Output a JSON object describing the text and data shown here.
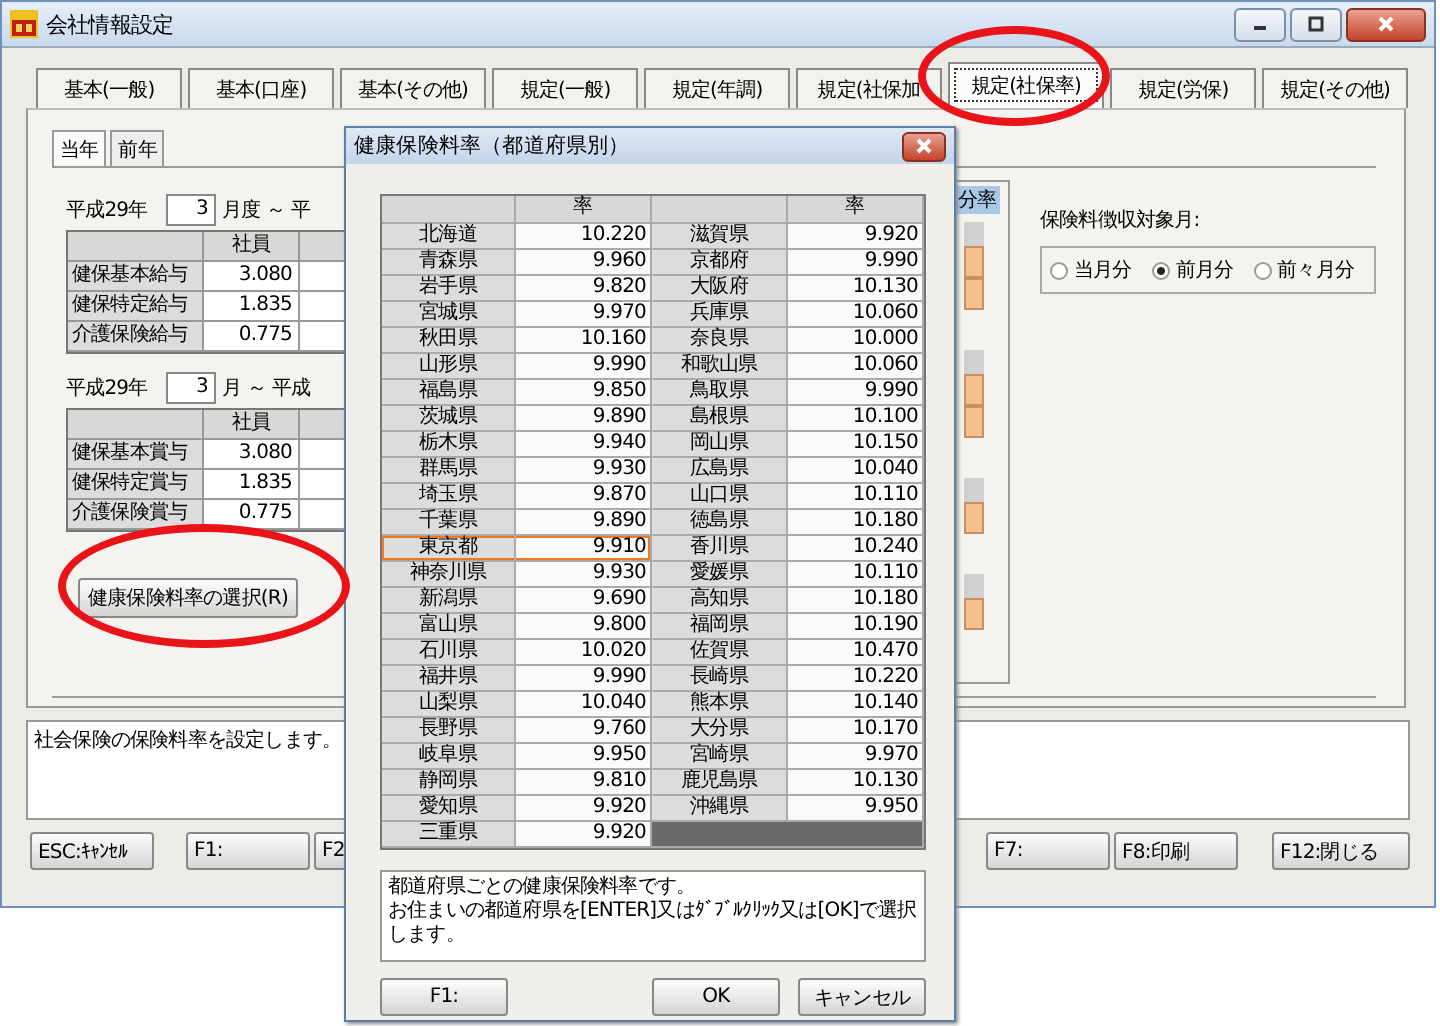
{
  "window": {
    "title": "会社情報設定",
    "tabs": [
      {
        "label": "基本(一般)",
        "selected": false
      },
      {
        "label": "基本(口座)",
        "selected": false
      },
      {
        "label": "基本(その他)",
        "selected": false
      },
      {
        "label": "規定(一般)",
        "selected": false
      },
      {
        "label": "規定(年調)",
        "selected": false
      },
      {
        "label": "規定(社保加",
        "selected": false
      },
      {
        "label": "規定(社保率)",
        "selected": true
      },
      {
        "label": "規定(労保)",
        "selected": false
      },
      {
        "label": "規定(その他)",
        "selected": false
      }
    ],
    "sub_tabs": [
      {
        "label": "当年",
        "selected": true
      },
      {
        "label": "前年",
        "selected": false
      }
    ],
    "periods": [
      {
        "era": "平成29年",
        "month": "3",
        "suffix": "月度 ～ 平",
        "column": "社員",
        "rows": [
          {
            "label": "健保基本給与",
            "value": "3.080"
          },
          {
            "label": "健保特定給与",
            "value": "1.835"
          },
          {
            "label": "介護保険給与",
            "value": "0.775"
          }
        ]
      },
      {
        "era": "平成29年",
        "month": "3",
        "suffix": "月 ～ 平成",
        "column": "社員",
        "rows": [
          {
            "label": "健保基本賞与",
            "value": "3.080"
          },
          {
            "label": "健保特定賞与",
            "value": "1.835"
          },
          {
            "label": "介護保険賞与",
            "value": "0.775"
          }
        ]
      }
    ],
    "rate_button": "健康保険料率の選択(R)",
    "partial_header": "分率",
    "collection_month": {
      "label": "保険料徴収対象月:",
      "options": [
        {
          "label": "当月分",
          "selected": false
        },
        {
          "label": "前月分",
          "selected": true
        },
        {
          "label": "前々月分",
          "selected": false
        }
      ]
    },
    "description": "社会保険の保険料率を設定します。",
    "function_keys": {
      "left": [
        "ESC:ｷｬﾝｾﾙ",
        "F1:",
        "F2"
      ],
      "right": [
        "F7:",
        "F8:印刷",
        "F12:閉じる"
      ]
    }
  },
  "dialog": {
    "title": "健康保険料率（都道府県別）",
    "columns": [
      "率",
      "率"
    ],
    "rows": [
      {
        "left": {
          "name": "北海道",
          "rate": "10.220",
          "selected": false
        },
        "right": {
          "name": "滋賀県",
          "rate": "9.920",
          "selected": false
        }
      },
      {
        "left": {
          "name": "青森県",
          "rate": "9.960",
          "selected": false
        },
        "right": {
          "name": "京都府",
          "rate": "9.990",
          "selected": false
        }
      },
      {
        "left": {
          "name": "岩手県",
          "rate": "9.820",
          "selected": false
        },
        "right": {
          "name": "大阪府",
          "rate": "10.130",
          "selected": false
        }
      },
      {
        "left": {
          "name": "宮城県",
          "rate": "9.970",
          "selected": false
        },
        "right": {
          "name": "兵庫県",
          "rate": "10.060",
          "selected": false
        }
      },
      {
        "left": {
          "name": "秋田県",
          "rate": "10.160",
          "selected": false
        },
        "right": {
          "name": "奈良県",
          "rate": "10.000",
          "selected": false
        }
      },
      {
        "left": {
          "name": "山形県",
          "rate": "9.990",
          "selected": false
        },
        "right": {
          "name": "和歌山県",
          "rate": "10.060",
          "selected": false
        }
      },
      {
        "left": {
          "name": "福島県",
          "rate": "9.850",
          "selected": false
        },
        "right": {
          "name": "鳥取県",
          "rate": "9.990",
          "selected": false
        }
      },
      {
        "left": {
          "name": "茨城県",
          "rate": "9.890",
          "selected": false
        },
        "right": {
          "name": "島根県",
          "rate": "10.100",
          "selected": false
        }
      },
      {
        "left": {
          "name": "栃木県",
          "rate": "9.940",
          "selected": false
        },
        "right": {
          "name": "岡山県",
          "rate": "10.150",
          "selected": false
        }
      },
      {
        "left": {
          "name": "群馬県",
          "rate": "9.930",
          "selected": false
        },
        "right": {
          "name": "広島県",
          "rate": "10.040",
          "selected": false
        }
      },
      {
        "left": {
          "name": "埼玉県",
          "rate": "9.870",
          "selected": false
        },
        "right": {
          "name": "山口県",
          "rate": "10.110",
          "selected": false
        }
      },
      {
        "left": {
          "name": "千葉県",
          "rate": "9.890",
          "selected": false
        },
        "right": {
          "name": "徳島県",
          "rate": "10.180",
          "selected": false
        }
      },
      {
        "left": {
          "name": "東京都",
          "rate": "9.910",
          "selected": true
        },
        "right": {
          "name": "香川県",
          "rate": "10.240",
          "selected": false
        }
      },
      {
        "left": {
          "name": "神奈川県",
          "rate": "9.930",
          "selected": false
        },
        "right": {
          "name": "愛媛県",
          "rate": "10.110",
          "selected": false
        }
      },
      {
        "left": {
          "name": "新潟県",
          "rate": "9.690",
          "selected": false
        },
        "right": {
          "name": "高知県",
          "rate": "10.180",
          "selected": false
        }
      },
      {
        "left": {
          "name": "富山県",
          "rate": "9.800",
          "selected": false
        },
        "right": {
          "name": "福岡県",
          "rate": "10.190",
          "selected": false
        }
      },
      {
        "left": {
          "name": "石川県",
          "rate": "10.020",
          "selected": false
        },
        "right": {
          "name": "佐賀県",
          "rate": "10.470",
          "selected": false
        }
      },
      {
        "left": {
          "name": "福井県",
          "rate": "9.990",
          "selected": false
        },
        "right": {
          "name": "長崎県",
          "rate": "10.220",
          "selected": false
        }
      },
      {
        "left": {
          "name": "山梨県",
          "rate": "10.040",
          "selected": false
        },
        "right": {
          "name": "熊本県",
          "rate": "10.140",
          "selected": false
        }
      },
      {
        "left": {
          "name": "長野県",
          "rate": "9.760",
          "selected": false
        },
        "right": {
          "name": "大分県",
          "rate": "10.170",
          "selected": false
        }
      },
      {
        "left": {
          "name": "岐阜県",
          "rate": "9.950",
          "selected": false
        },
        "right": {
          "name": "宮崎県",
          "rate": "9.970",
          "selected": false
        }
      },
      {
        "left": {
          "name": "静岡県",
          "rate": "9.810",
          "selected": false
        },
        "right": {
          "name": "鹿児島県",
          "rate": "10.130",
          "selected": false
        }
      },
      {
        "left": {
          "name": "愛知県",
          "rate": "9.920",
          "selected": false
        },
        "right": {
          "name": "沖縄県",
          "rate": "9.950",
          "selected": false
        }
      },
      {
        "left": {
          "name": "三重県",
          "rate": "9.920",
          "selected": false
        }
      }
    ],
    "description": [
      "都道府県ごとの健康保険料率です。",
      "お住まいの都道府県を[ENTER]又はﾀﾞﾌﾞﾙｸﾘｯｸ又は[OK]で選択します。"
    ],
    "buttons": [
      "F1:",
      "OK",
      "キャンセル"
    ]
  },
  "annotations": [
    {
      "kind": "ellipse"
    },
    {
      "kind": "ellipse"
    }
  ]
}
